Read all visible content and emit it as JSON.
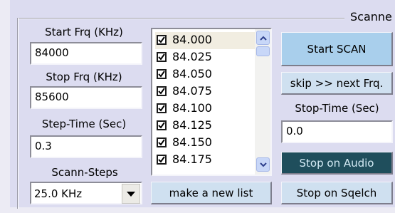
{
  "group": {
    "title": "Scanne"
  },
  "start_frq": {
    "label": "Start Frq (KHz)",
    "value": "84000"
  },
  "stop_frq": {
    "label": "Stop Frq (KHz)",
    "value": "85600"
  },
  "step_time": {
    "label": "Step-Time (Sec)",
    "value": "0.3"
  },
  "scann_steps": {
    "label": "Scann-Steps",
    "selected": "25.0 KHz"
  },
  "freq_list": {
    "items": [
      {
        "label": "84.000",
        "checked": true
      },
      {
        "label": "84.025",
        "checked": true
      },
      {
        "label": "84.050",
        "checked": true
      },
      {
        "label": "84.075",
        "checked": true
      },
      {
        "label": "84.100",
        "checked": true
      },
      {
        "label": "84.125",
        "checked": true
      },
      {
        "label": "84.150",
        "checked": true
      },
      {
        "label": "84.175",
        "checked": true
      }
    ]
  },
  "make_list_button": "make a new list",
  "start_scan_button": "Start SCAN",
  "skip_button": "skip >> next Frq.",
  "stop_time": {
    "label": "Stop-Time (Sec)",
    "value": "0.0"
  },
  "stop_audio_button": "Stop on Audio",
  "stop_sqelch_button": "Stop on Sqelch",
  "colors": {
    "panel": "#dcdcf0",
    "button_light": "#cfe0f0",
    "button_blue": "#a9cfec",
    "button_dark": "#1f4e5c",
    "scrollbar_button": "#c8d7f8"
  }
}
